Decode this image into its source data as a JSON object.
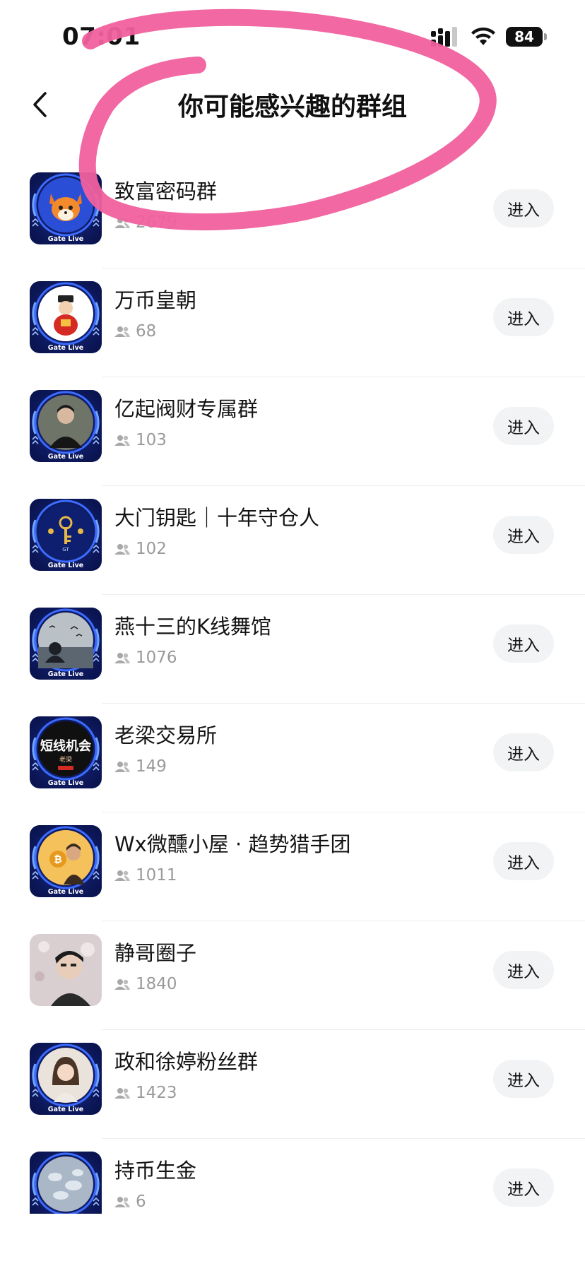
{
  "status_bar": {
    "time": "07:01",
    "battery": "84",
    "signal_icon": "cellular-signal-icon",
    "wifi_icon": "wifi-icon"
  },
  "header": {
    "back_icon": "chevron-left-icon",
    "title": "你可能感兴趣的群组"
  },
  "annotation": {
    "color": "#f0609e",
    "type": "hand-drawn-circle"
  },
  "groups": [
    {
      "name": "致富密码群",
      "members": "2679",
      "join_label": "进入",
      "avatar_badge": "Gate Live",
      "avatar_theme": "fox"
    },
    {
      "name": "万币皇朝",
      "members": "68",
      "join_label": "进入",
      "avatar_badge": "Gate Live",
      "avatar_theme": "emperor"
    },
    {
      "name": "亿起阀财专属群",
      "members": "103",
      "join_label": "进入",
      "avatar_badge": "Gate Live",
      "avatar_theme": "man-photo"
    },
    {
      "name": "大门钥匙｜十年守仓人",
      "members": "102",
      "join_label": "进入",
      "avatar_badge": "Gate Live",
      "avatar_theme": "key-logo"
    },
    {
      "name": "燕十三的K线舞馆",
      "members": "1076",
      "join_label": "进入",
      "avatar_badge": "Gate Live",
      "avatar_theme": "birds"
    },
    {
      "name": "老梁交易所",
      "members": "149",
      "join_label": "进入",
      "avatar_badge": "Gate Live",
      "avatar_theme": "text-sign",
      "avatar_text": "短线机会",
      "avatar_subtext": "老梁"
    },
    {
      "name": "Wx微醺小屋 · 趋势猎手团",
      "members": "1011",
      "join_label": "进入",
      "avatar_badge": "Gate Live",
      "avatar_theme": "bitcoin-man"
    },
    {
      "name": "静哥圈子",
      "members": "1840",
      "join_label": "进入",
      "avatar_badge": "",
      "avatar_theme": "photo"
    },
    {
      "name": "政和徐婷粉丝群",
      "members": "1423",
      "join_label": "进入",
      "avatar_badge": "Gate Live",
      "avatar_theme": "woman-photo"
    },
    {
      "name": "持币生金",
      "members": "6",
      "join_label": "进入",
      "avatar_badge": "",
      "avatar_theme": "clouds"
    }
  ]
}
